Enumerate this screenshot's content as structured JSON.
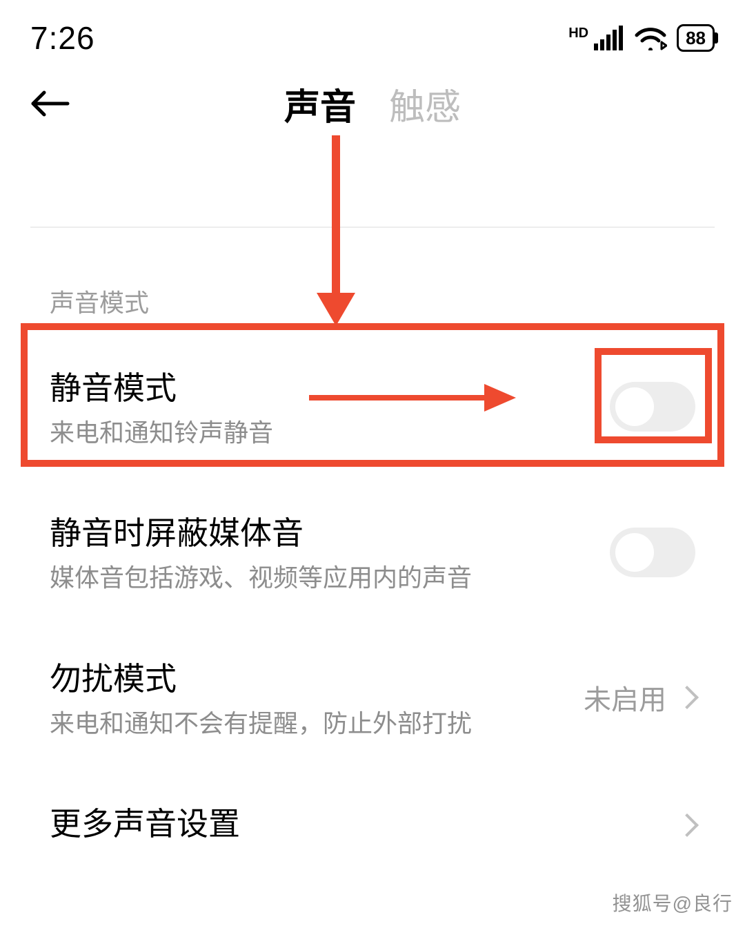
{
  "status": {
    "time": "7:26",
    "network_label": "HD",
    "battery_pct": "88"
  },
  "header": {
    "tabs": [
      {
        "label": "声音",
        "active": true
      },
      {
        "label": "触感",
        "active": false
      }
    ]
  },
  "section": {
    "label": "声音模式"
  },
  "rows": {
    "silent": {
      "title": "静音模式",
      "sub": "来电和通知铃声静音",
      "toggle": false
    },
    "media": {
      "title": "静音时屏蔽媒体音",
      "sub": "媒体音包括游戏、视频等应用内的声音",
      "toggle": false
    },
    "dnd": {
      "title": "勿扰模式",
      "sub": "来电和通知不会有提醒，防止外部打扰",
      "value": "未启用"
    },
    "more": {
      "title": "更多声音设置"
    }
  },
  "watermark": "搜狐号@良行"
}
